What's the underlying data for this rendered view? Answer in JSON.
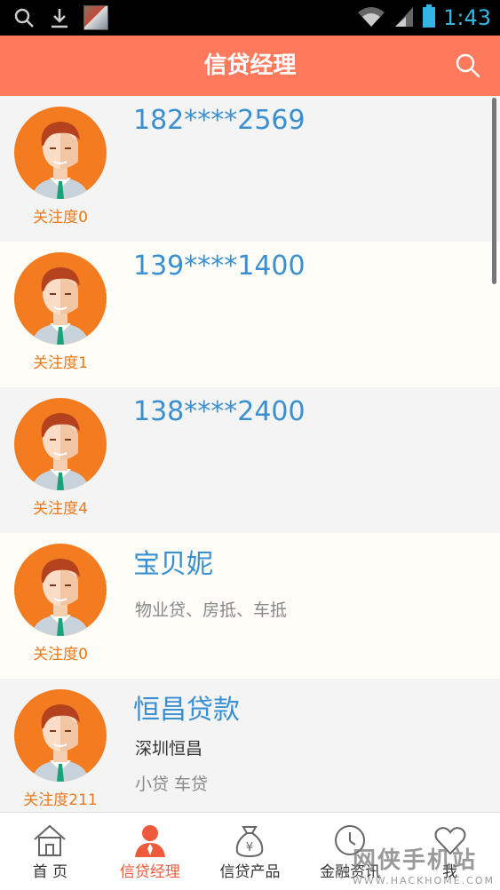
{
  "status_bar": {
    "time": "1:43",
    "icons": [
      "search-icon",
      "download-icon",
      "photo-thumbnail",
      "wifi-icon",
      "signal-icon",
      "battery-icon"
    ]
  },
  "header": {
    "title": "信贷经理",
    "search_icon": "search-icon"
  },
  "managers": [
    {
      "name": "182****2569",
      "attention": "关注度0",
      "sub1": "",
      "sub2": ""
    },
    {
      "name": "139****1400",
      "attention": "关注度1",
      "sub1": "",
      "sub2": ""
    },
    {
      "name": "138****2400",
      "attention": "关注度4",
      "sub1": "",
      "sub2": ""
    },
    {
      "name": "宝贝妮",
      "attention": "关注度0",
      "sub1": "",
      "sub2": "物业贷、房抵、车抵"
    },
    {
      "name": "恒昌贷款",
      "attention": "关注度211",
      "sub1": "深圳恒昌",
      "sub2": "小贷 车贷"
    }
  ],
  "bottom_nav": [
    {
      "label": "首 页",
      "icon": "home-icon",
      "active": false
    },
    {
      "label": "信贷经理",
      "icon": "manager-icon",
      "active": true
    },
    {
      "label": "信贷产品",
      "icon": "money-bag-icon",
      "active": false
    },
    {
      "label": "金融资讯",
      "icon": "news-icon",
      "active": false
    },
    {
      "label": "我",
      "icon": "profile-icon",
      "active": false
    }
  ],
  "watermark": {
    "main": "网侠手机站",
    "sub": "WWW.HACKHOME.COM"
  },
  "colors": {
    "accent": "#ff7a5c",
    "name_blue": "#3a8fd0",
    "attention_orange": "#e8791e",
    "active_tab": "#ef5a3c"
  }
}
